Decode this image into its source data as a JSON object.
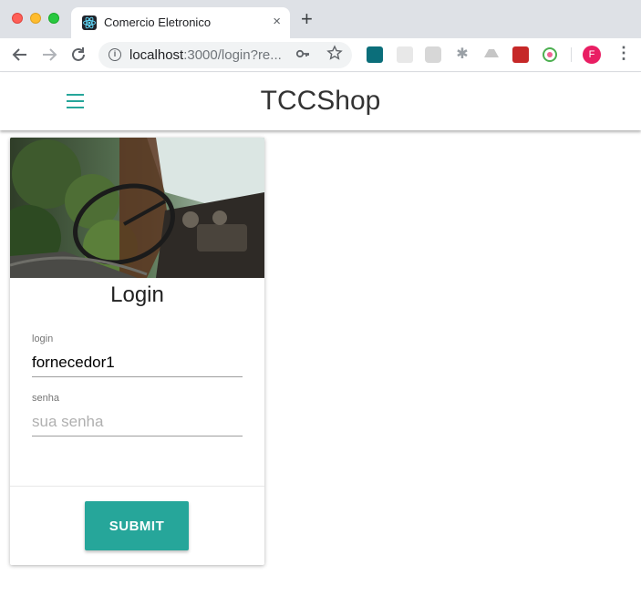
{
  "browser": {
    "tab_title": "Comercio Eletronico",
    "tab_close": "×",
    "new_tab": "+",
    "url_host": "localhost",
    "url_rest": ":3000/login?re...",
    "profile_initial": "F"
  },
  "app": {
    "title": "TCCShop",
    "accent_color": "#26a69a"
  },
  "login_card": {
    "heading": "Login",
    "login_label": "login",
    "login_value": "fornecedor1",
    "password_label": "senha",
    "password_placeholder": "sua senha",
    "submit_label": "SUBMIT"
  }
}
